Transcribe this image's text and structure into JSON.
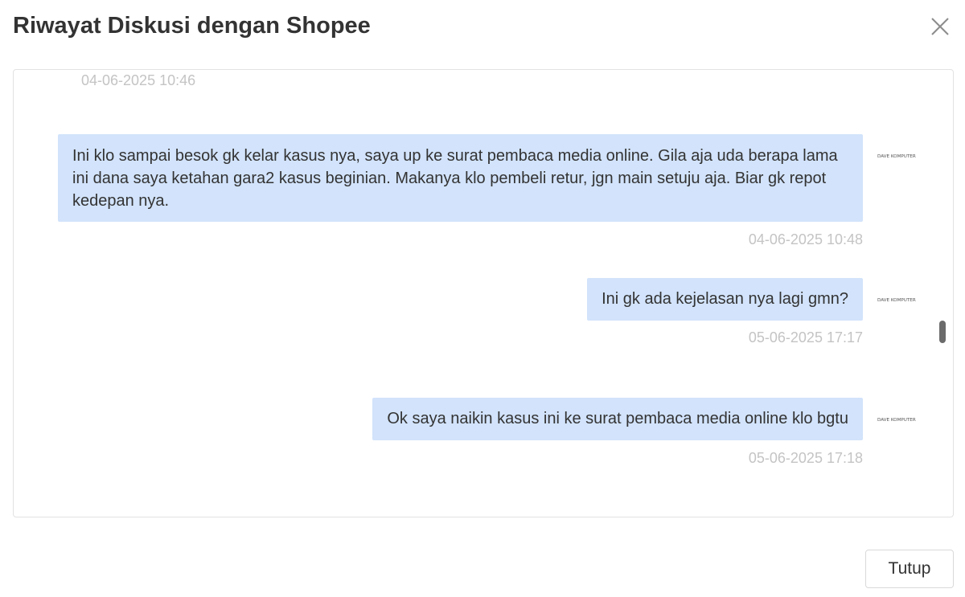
{
  "modal": {
    "title": "Riwayat Diskusi dengan Shopee",
    "close_icon": "close-icon",
    "close_button_label": "Tutup"
  },
  "chat": {
    "top_timestamp": "04-06-2025 10:46",
    "messages": [
      {
        "text": "Ini klo sampai besok gk kelar kasus nya, saya up ke surat pembaca media online. Gila aja uda berapa lama ini dana saya ketahan gara2 kasus beginian. Makanya klo pembeli retur, jgn main setuju aja. Biar gk repot kedepan nya.",
        "timestamp": "04-06-2025 10:48",
        "avatar_text": "DAVE KOMPUTER"
      },
      {
        "text": "Ini gk ada kejelasan nya lagi gmn?",
        "timestamp": "05-06-2025 17:17",
        "avatar_text": "DAVE KOMPUTER"
      },
      {
        "text": "Ok saya naikin kasus ini ke surat pembaca media online klo bgtu",
        "timestamp": "05-06-2025 17:18",
        "avatar_text": "DAVE KOMPUTER"
      }
    ]
  },
  "colors": {
    "bubble_bg": "#d2e3fb",
    "timestamp": "#c4c4c4",
    "title": "#333333",
    "panel_border": "#e2e2e2"
  }
}
